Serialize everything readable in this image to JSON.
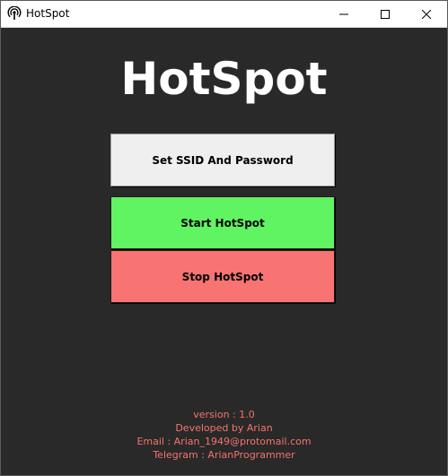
{
  "window": {
    "title": "HotSpot",
    "icons": {
      "app": "hotspot-broadcast-icon",
      "minimize": "minimize-icon",
      "maximize": "maximize-icon",
      "close": "close-icon"
    }
  },
  "main": {
    "title": "HotSpot",
    "buttons": {
      "ssid_label": "Set SSID And Password",
      "start_label": "Start HotSpot",
      "stop_label": "Stop HotSpot"
    }
  },
  "footer": {
    "version": "version : 1.0",
    "developer": "Developed by Arian",
    "email": "Email : Arian_1949@protomail.com",
    "telegram": "Telegram : ArianProgrammer"
  },
  "colors": {
    "background": "#292929",
    "ssid_button": "#efefef",
    "start_button": "#60f362",
    "stop_button": "#f77473",
    "footer_text": "#f3736f"
  }
}
